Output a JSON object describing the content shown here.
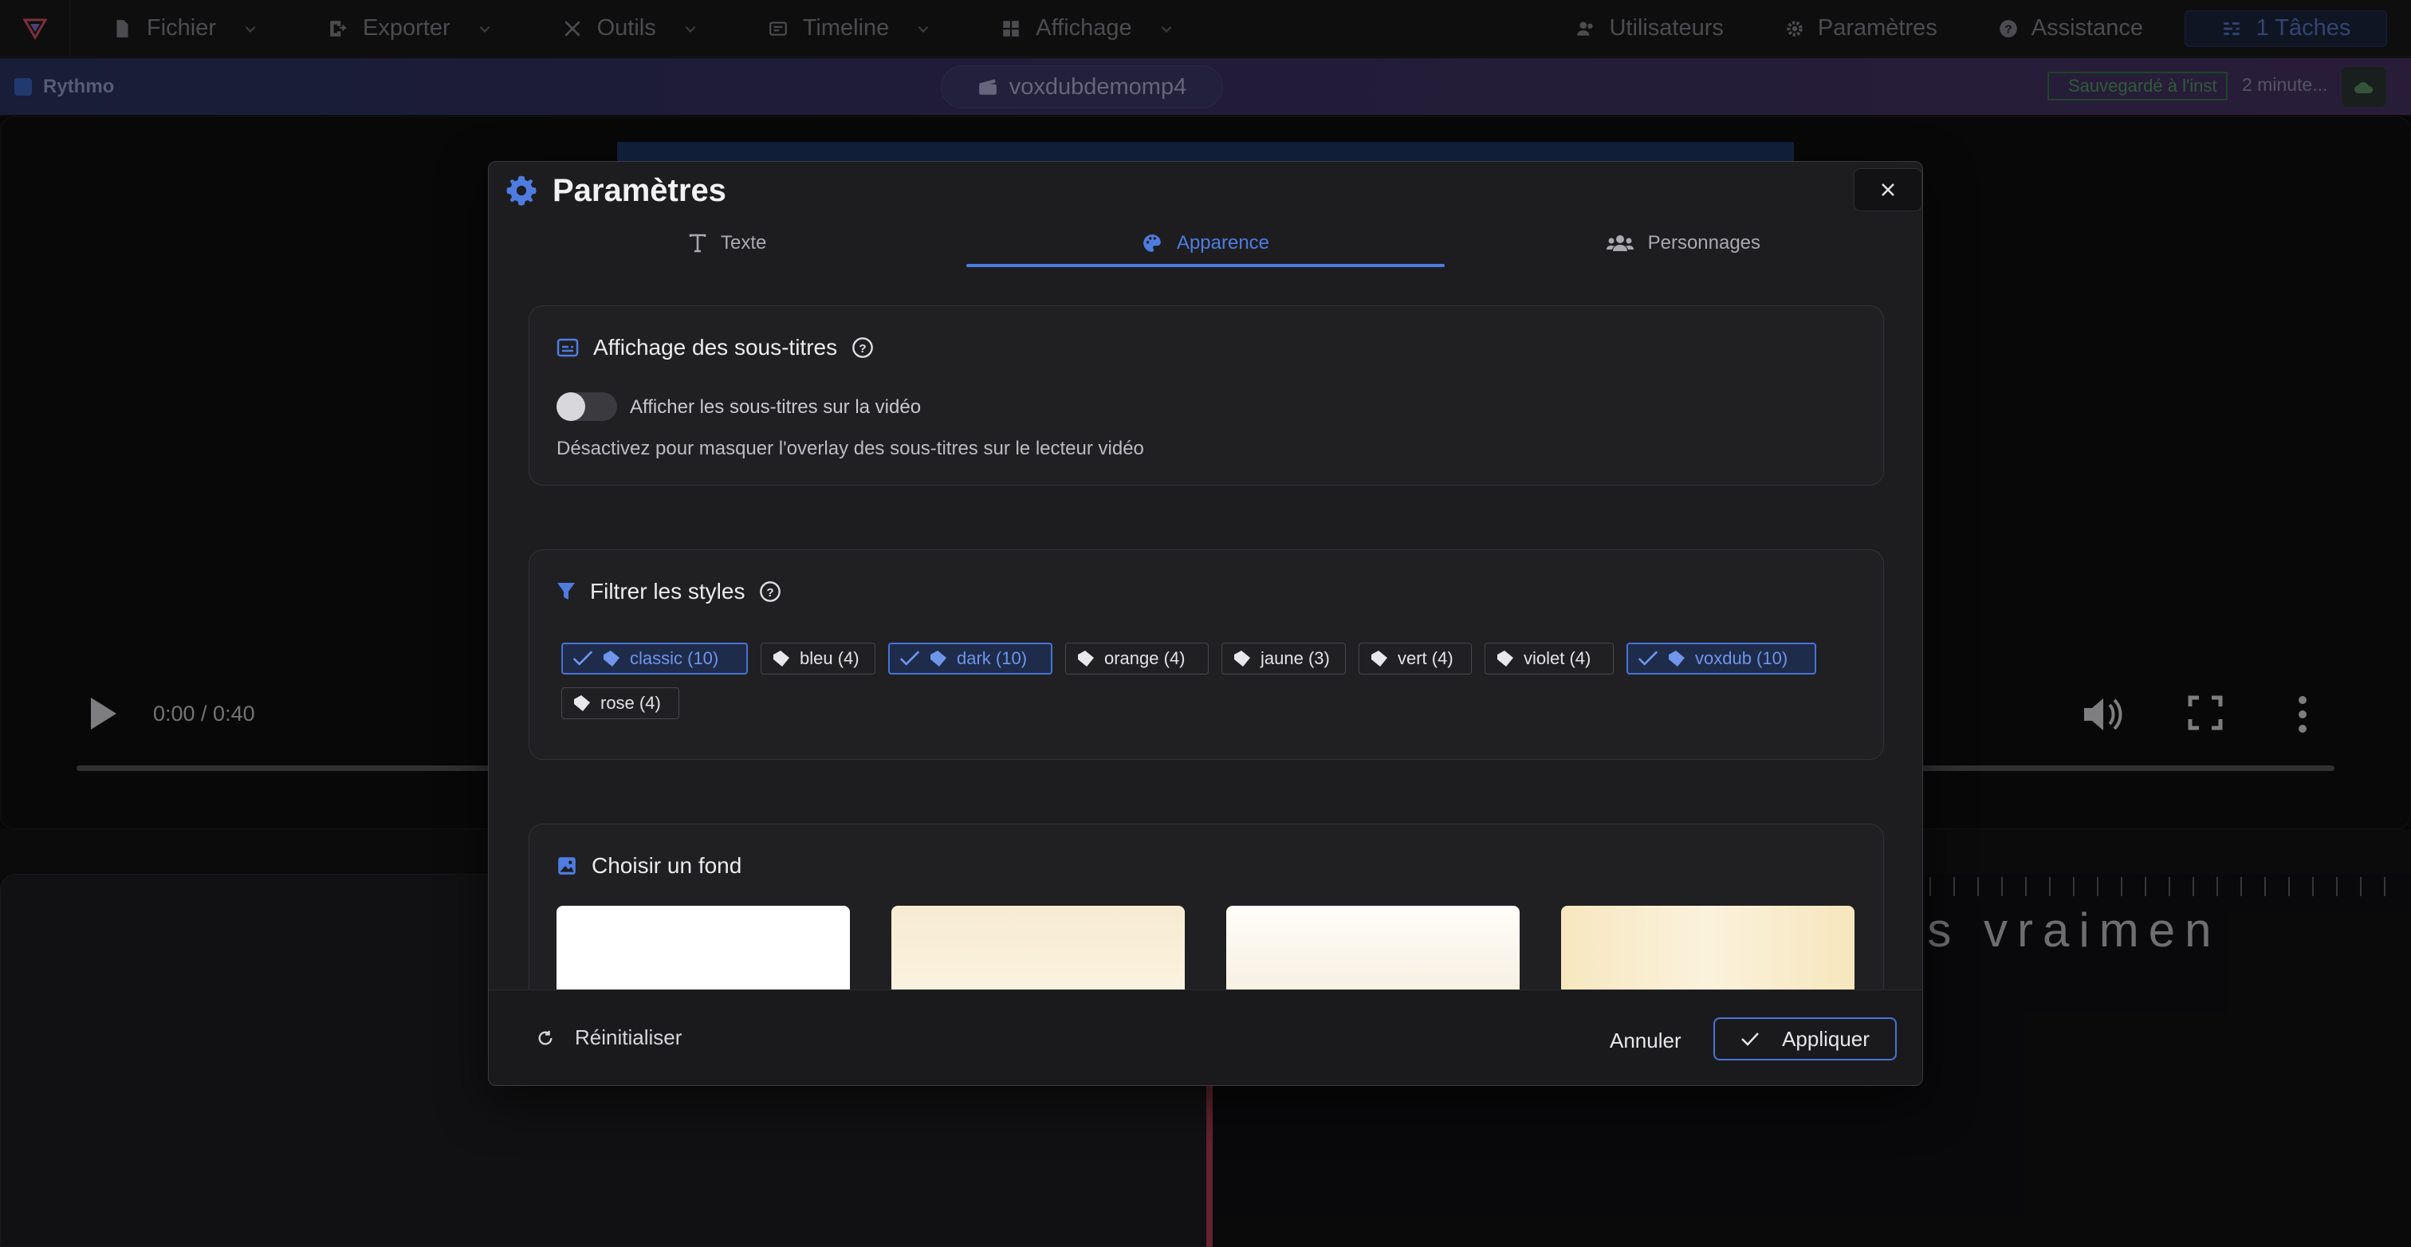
{
  "menubar": {
    "items": [
      {
        "label": "Fichier",
        "icon": "file-icon"
      },
      {
        "label": "Exporter",
        "icon": "export-icon"
      },
      {
        "label": "Outils",
        "icon": "tools-icon"
      },
      {
        "label": "Timeline",
        "icon": "timeline-icon"
      },
      {
        "label": "Affichage",
        "icon": "layout-icon"
      }
    ],
    "right": {
      "users": "Utilisateurs",
      "settings": "Paramètres",
      "help": "Assistance",
      "tasks": "1 Tâches"
    }
  },
  "subbar": {
    "brand": "Rythmo",
    "file_name": "voxdubdemomp4",
    "saved_status": "Sauvegardé à l'inst",
    "time_ago": "2 minute..."
  },
  "player": {
    "timecode": "0:00 / 0:40",
    "progress": 0
  },
  "timeline": {
    "rythmo_text": "es vraimen"
  },
  "modal": {
    "title": "Paramètres",
    "tabs": [
      {
        "label": "Texte",
        "icon": "text-icon",
        "active": false
      },
      {
        "label": "Apparence",
        "icon": "palette-icon",
        "active": true
      },
      {
        "label": "Personnages",
        "icon": "users-icon",
        "active": false
      }
    ],
    "subtitles_card": {
      "title": "Affichage des sous-titres",
      "toggle_label": "Afficher les sous-titres sur la vidéo",
      "toggle_on": false,
      "hint": "Désactivez pour masquer l'overlay des sous-titres sur le lecteur vidéo"
    },
    "filter_card": {
      "title": "Filtrer les styles",
      "chips": [
        {
          "label": "classic (10)",
          "selected": true
        },
        {
          "label": "bleu (4)",
          "selected": false
        },
        {
          "label": "dark (10)",
          "selected": true
        },
        {
          "label": "orange (4)",
          "selected": false
        },
        {
          "label": "jaune (3)",
          "selected": false
        },
        {
          "label": "vert (4)",
          "selected": false
        },
        {
          "label": "violet (4)",
          "selected": false
        },
        {
          "label": "voxdub (10)",
          "selected": true
        },
        {
          "label": "rose (4)",
          "selected": false
        }
      ]
    },
    "background_card": {
      "title": "Choisir un fond",
      "swatches": [
        "#ffffff",
        "#f7edd6",
        "#fbf7ee",
        "#f8ebc8"
      ]
    },
    "footer": {
      "reset": "Réinitialiser",
      "cancel": "Annuler",
      "apply": "Appliquer"
    }
  },
  "colors": {
    "accent": "#4e7ce0",
    "selected_chip_bg": "#1e2b4a"
  }
}
